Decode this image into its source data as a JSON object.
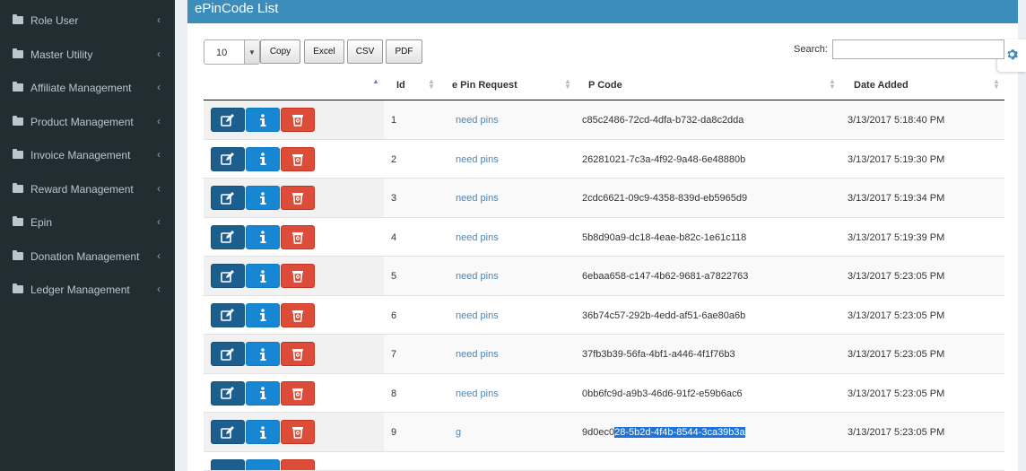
{
  "sidebar": {
    "items": [
      {
        "label": "Role User"
      },
      {
        "label": "Master Utility"
      },
      {
        "label": "Affiliate Management"
      },
      {
        "label": "Product Management"
      },
      {
        "label": "Invoice Management"
      },
      {
        "label": "Reward Management"
      },
      {
        "label": "Epin"
      },
      {
        "label": "Donation Management"
      },
      {
        "label": "Ledger Management"
      }
    ],
    "chevron": "‹"
  },
  "panel": {
    "title": "ePinCode List"
  },
  "toolbar": {
    "length_value": "10",
    "copy_label": "Copy",
    "excel_label": "Excel",
    "csv_label": "CSV",
    "pdf_label": "PDF",
    "search_label": "Search:",
    "search_value": ""
  },
  "table": {
    "headers": {
      "id": "Id",
      "request": "e Pin Request",
      "pcode": "P Code",
      "date": "Date Added"
    },
    "rows": [
      {
        "id": "1",
        "request": "need pins",
        "pcode": "c85c2486-72cd-4dfa-b732-da8c2dda",
        "date": "3/13/2017 5:18:40 PM"
      },
      {
        "id": "2",
        "request": "need pins",
        "pcode": "26281021-7c3a-4f92-9a48-6e48880b",
        "date": "3/13/2017 5:19:30 PM"
      },
      {
        "id": "3",
        "request": "need pins",
        "pcode": "2cdc6621-09c9-4358-839d-eb5965d9",
        "date": "3/13/2017 5:19:34 PM"
      },
      {
        "id": "4",
        "request": "need pins",
        "pcode": "5b8d90a9-dc18-4eae-b82c-1e61c118",
        "date": "3/13/2017 5:19:39 PM"
      },
      {
        "id": "5",
        "request": "need pins",
        "pcode": "6ebaa658-c147-4b62-9681-a7822763",
        "date": "3/13/2017 5:23:05 PM"
      },
      {
        "id": "6",
        "request": "need pins",
        "pcode": "36b74c57-292b-4edd-af51-6ae80a6b",
        "date": "3/13/2017 5:23:05 PM"
      },
      {
        "id": "7",
        "request": "need pins",
        "pcode": "37fb3b39-56fa-4bf1-a446-4f1f76b3",
        "date": "3/13/2017 5:23:05 PM"
      },
      {
        "id": "8",
        "request": "need pins",
        "pcode": "0bb6fc9d-a9b3-46d6-91f2-e59b6ac6",
        "date": "3/13/2017 5:23:05 PM"
      }
    ],
    "row9": {
      "id": "9",
      "request": "g",
      "pcode_plain": "9d0ec0",
      "pcode_selected": "28-5b2d-4f4b-8544-3ca39b3a",
      "date": "3/13/2017 5:23:05 PM"
    }
  },
  "icons": {
    "edit": "edit-icon",
    "info": "info-icon",
    "delete": "trash-icon",
    "settings": "gear-icon",
    "folder": "folder-icon"
  },
  "colors": {
    "sidebar_bg": "#222d32",
    "header_blue": "#3c8dbc",
    "edit_btn": "#1c5f8f",
    "info_btn": "#1787d3",
    "delete_btn": "#dd4b39",
    "link": "#4b86b4"
  }
}
